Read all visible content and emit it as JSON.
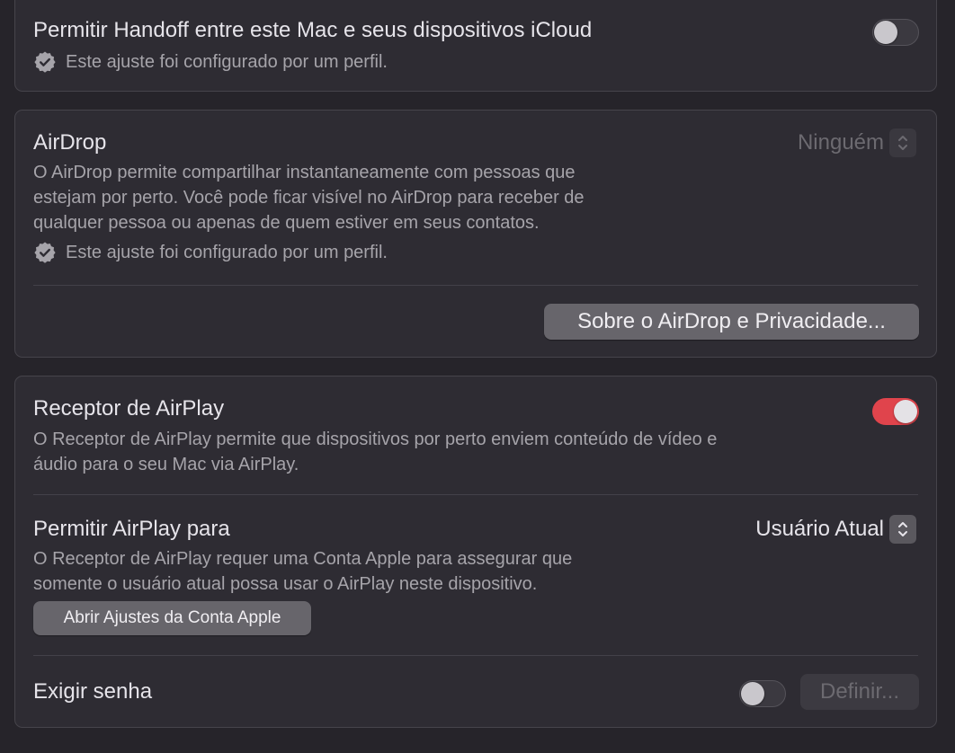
{
  "handoff": {
    "title": "Permitir Handoff entre este Mac e seus dispositivos iCloud",
    "profile_note": "Este ajuste foi configurado por um perfil.",
    "toggle_on": false
  },
  "airdrop": {
    "title": "AirDrop",
    "select_value": "Ninguém",
    "description_lines": [
      "O AirDrop permite compartilhar instantaneamente com pessoas que",
      "estejam por perto. Você pode ficar visível no AirDrop para receber de",
      "qualquer pessoa ou apenas de quem estiver em seus contatos."
    ],
    "profile_note": "Este ajuste foi configurado por um perfil.",
    "privacy_button": "Sobre o AirDrop e Privacidade..."
  },
  "airplay_receiver": {
    "title": "Receptor de AirPlay",
    "description_lines": [
      "O Receptor de AirPlay permite que dispositivos por perto enviem conteúdo de vídeo e",
      "áudio para o seu Mac via AirPlay."
    ],
    "toggle_on": true,
    "accent_color": "#e0444c"
  },
  "allow_airplay": {
    "title": "Permitir AirPlay para",
    "select_value": "Usuário Atual",
    "description_lines": [
      "O Receptor de AirPlay requer uma Conta Apple para assegurar que",
      "somente o usuário atual possa usar o AirPlay neste dispositivo."
    ],
    "account_button": "Abrir Ajustes da Conta Apple"
  },
  "password": {
    "title": "Exigir senha",
    "toggle_on": false,
    "define_button": "Definir..."
  },
  "icons": {
    "profile_badge": "checkmark-seal-icon",
    "select_chevron": "chevron-up-down-icon"
  }
}
